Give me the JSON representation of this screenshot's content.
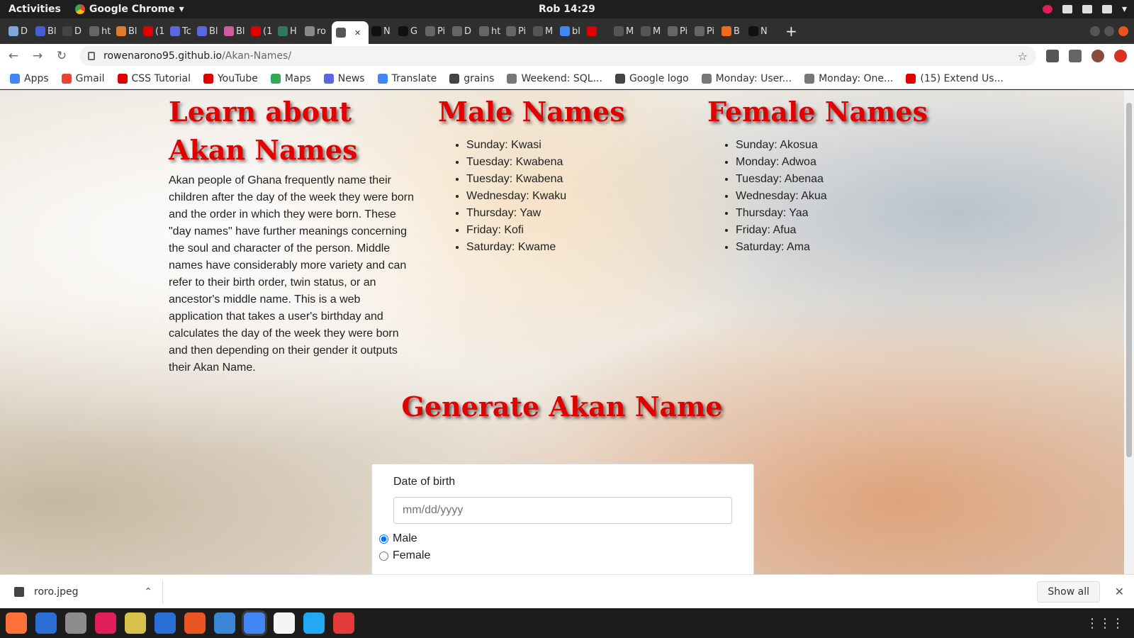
{
  "system": {
    "activities": "Activities",
    "app_name": "Google Chrome",
    "clock": "Rob 14:29"
  },
  "tabs": [
    {
      "label": "D",
      "color": "#7ea7d8"
    },
    {
      "label": "Bl",
      "color": "#4a5bd6"
    },
    {
      "label": "D",
      "color": "#444444"
    },
    {
      "label": "ht",
      "color": "#666666"
    },
    {
      "label": "Bl",
      "color": "#e07b2b"
    },
    {
      "label": "(1",
      "color": "#e00000"
    },
    {
      "label": "Tc",
      "color": "#5b67e0"
    },
    {
      "label": "Bl",
      "color": "#5b67e0"
    },
    {
      "label": "Bl",
      "color": "#d45aa0"
    },
    {
      "label": "(1",
      "color": "#e00000"
    },
    {
      "label": "H",
      "color": "#2f7a5a"
    },
    {
      "label": "ro",
      "color": "#888888"
    },
    {
      "label": "",
      "color": "#555555",
      "active": true
    },
    {
      "label": "N",
      "color": "#111111"
    },
    {
      "label": "G",
      "color": "#111111"
    },
    {
      "label": "Pi",
      "color": "#666666"
    },
    {
      "label": "D",
      "color": "#666666"
    },
    {
      "label": "ht",
      "color": "#666666"
    },
    {
      "label": "Pi",
      "color": "#666666"
    },
    {
      "label": "M",
      "color": "#555555"
    },
    {
      "label": "bl",
      "color": "#4285f4"
    },
    {
      "label": "",
      "color": "#e00000"
    },
    {
      "label": "M",
      "color": "#555555"
    },
    {
      "label": "M",
      "color": "#555555"
    },
    {
      "label": "Pi",
      "color": "#666666"
    },
    {
      "label": "Pi",
      "color": "#666666"
    },
    {
      "label": "B",
      "color": "#f06a1a"
    },
    {
      "label": "N",
      "color": "#111111"
    }
  ],
  "address": {
    "domain": "rowenarono95.github.io",
    "path": "/Akan-Names/"
  },
  "bookmarks": [
    {
      "label": "Apps",
      "color": "#4285f4"
    },
    {
      "label": "Gmail",
      "color": "#ea4335"
    },
    {
      "label": "CSS Tutorial",
      "color": "#e00000"
    },
    {
      "label": "YouTube",
      "color": "#e00000"
    },
    {
      "label": "Maps",
      "color": "#34a853"
    },
    {
      "label": "News",
      "color": "#5b67e0"
    },
    {
      "label": "Translate",
      "color": "#4285f4"
    },
    {
      "label": "grains",
      "color": "#444444"
    },
    {
      "label": "Weekend: SQL...",
      "color": "#777777"
    },
    {
      "label": "Google logo",
      "color": "#444444"
    },
    {
      "label": "Monday: User...",
      "color": "#777777"
    },
    {
      "label": "Monday: One...",
      "color": "#777777"
    },
    {
      "label": "(15) Extend Us...",
      "color": "#e00000"
    }
  ],
  "page": {
    "about_title_line1": "Learn about",
    "about_title_line2": "Akan Names",
    "about_text": "Akan people of Ghana frequently name their children after the day of the week they were born and the order in which they were born. These \"day names\" have further meanings concerning the soul and character of the person. Middle names have considerably more variety and can refer to their birth order, twin status, or an ancestor's middle name. This is a web application that takes a user's birthday and calculates the day of the week they were born and then depending on their gender it outputs their Akan Name.",
    "male_title": "Male Names",
    "male_names": [
      "Sunday: Kwasi",
      "Tuesday: Kwabena",
      "Tuesday: Kwabena",
      "Wednesday: Kwaku",
      "Thursday: Yaw",
      "Friday: Kofi",
      "Saturday: Kwame"
    ],
    "female_title": "Female Names",
    "female_names": [
      "Sunday: Akosua",
      "Monday: Adwoa",
      "Tuesday: Abenaa",
      "Wednesday: Akua",
      "Thursday: Yaa",
      "Friday: Afua",
      "Saturday: Ama"
    ],
    "generate_title": "Generate Akan Name",
    "form": {
      "dob_label": "Date of birth",
      "dob_placeholder": "mm/dd/yyyy",
      "male_label": "Male",
      "female_label": "Female",
      "selected_gender": "Male"
    }
  },
  "downloads": {
    "file_name": "roro.jpeg",
    "show_all": "Show all"
  },
  "dock": [
    {
      "name": "firefox",
      "color": "#ff7139"
    },
    {
      "name": "thunderbird",
      "color": "#2a6fd6"
    },
    {
      "name": "files",
      "color": "#8d8d8d"
    },
    {
      "name": "slack",
      "color": "#e01e5a"
    },
    {
      "name": "password",
      "color": "#d8c24a"
    },
    {
      "name": "writer",
      "color": "#2a6fd6"
    },
    {
      "name": "software",
      "color": "#e95420"
    },
    {
      "name": "help",
      "color": "#3a86d6"
    },
    {
      "name": "chrome",
      "color": "#4285f4",
      "active": true
    },
    {
      "name": "text-editor",
      "color": "#f5f5f5"
    },
    {
      "name": "vscode",
      "color": "#23a9f2"
    },
    {
      "name": "screenshot",
      "color": "#e33a3a"
    }
  ]
}
